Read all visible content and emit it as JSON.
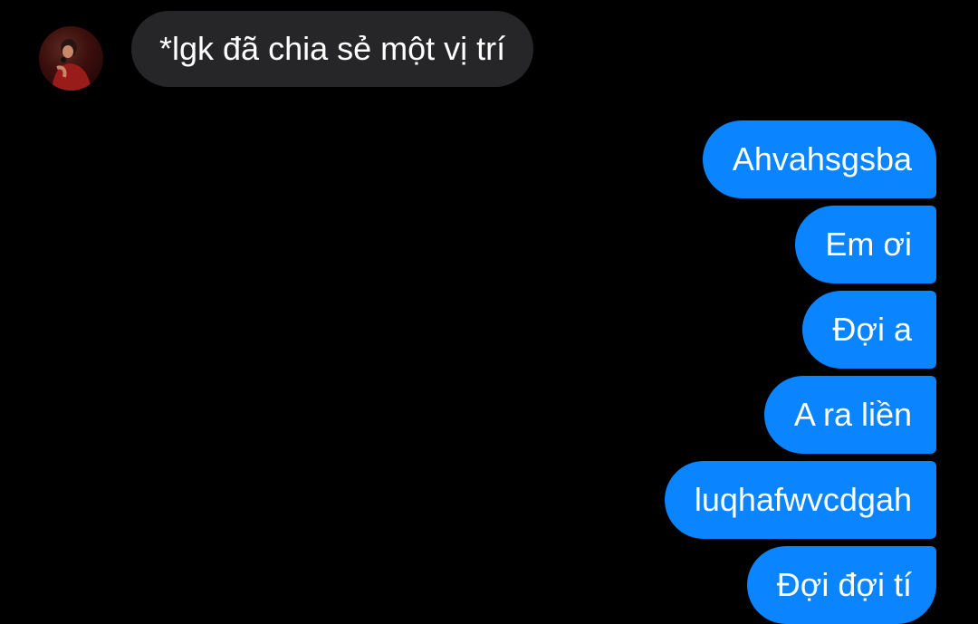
{
  "incoming": {
    "message": "*lgk đã chia sẻ một vị trí"
  },
  "outgoing": [
    {
      "text": "Ahvahsgsba"
    },
    {
      "text": "Em ơi"
    },
    {
      "text": "Đợi a"
    },
    {
      "text": "A ra liền"
    },
    {
      "text": "luqhafwvcdgah"
    },
    {
      "text": "Đợi đợi tí"
    }
  ],
  "colors": {
    "background": "#000000",
    "incoming_bubble": "#262628",
    "outgoing_bubble": "#0a84ff",
    "text": "#ffffff"
  }
}
